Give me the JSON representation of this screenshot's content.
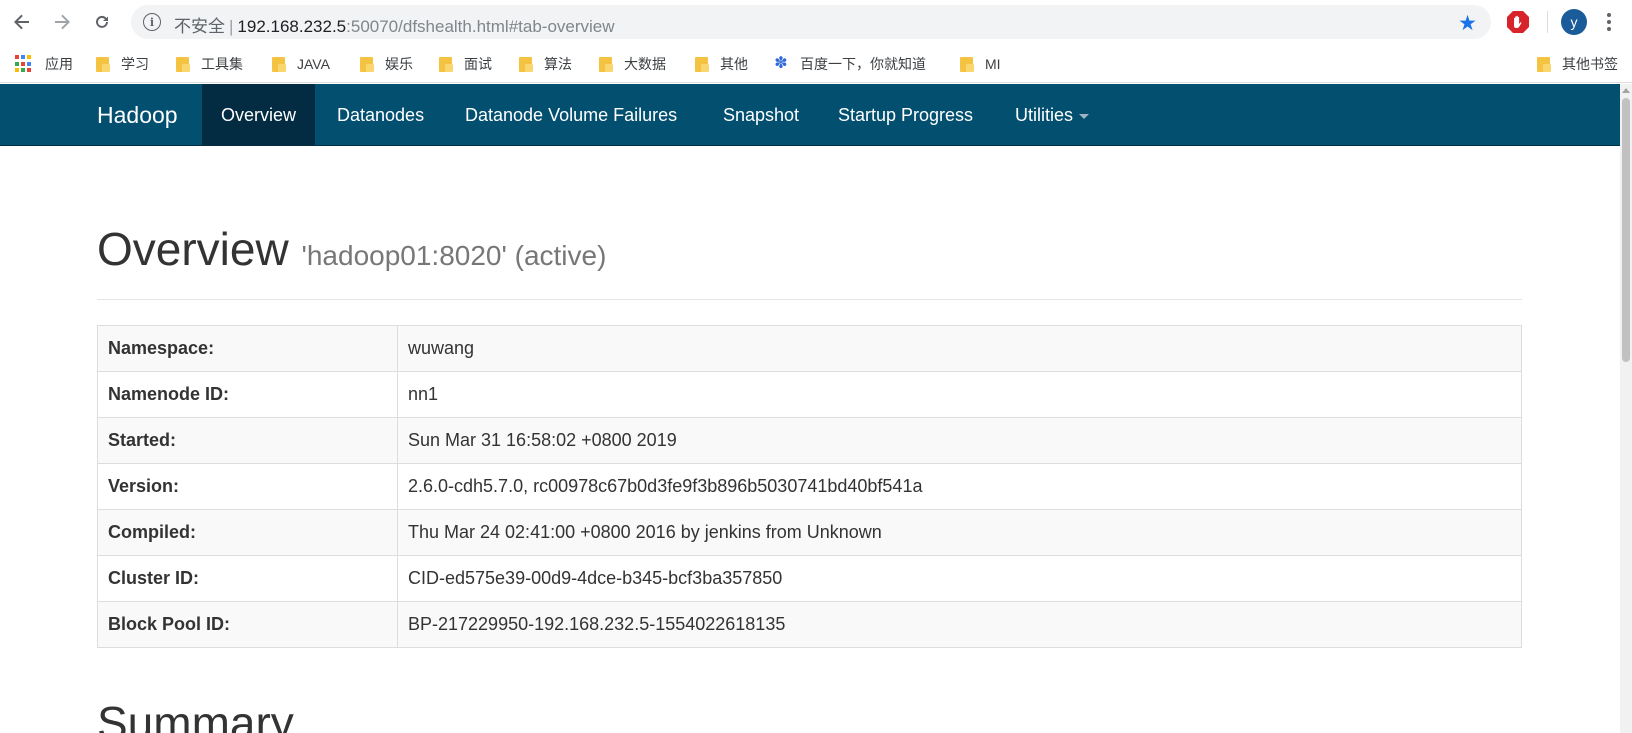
{
  "browser": {
    "nav": {
      "back_icon": "back-arrow-icon",
      "forward_icon": "forward-arrow-icon",
      "reload_icon": "reload-icon"
    },
    "omnibox": {
      "security_label": "不安全",
      "separator": "|",
      "url_host": "192.168.232.5",
      "url_rest": ":50070/dfshealth.html#tab-overview"
    },
    "avatar_initial": "y"
  },
  "bookmarks": [
    {
      "label": "应用",
      "icon": "apps-grid-icon"
    },
    {
      "label": "学习",
      "icon": "folder-icon"
    },
    {
      "label": "工具集",
      "icon": "folder-icon"
    },
    {
      "label": "JAVA",
      "icon": "folder-icon"
    },
    {
      "label": "娱乐",
      "icon": "folder-icon"
    },
    {
      "label": "面试",
      "icon": "folder-icon"
    },
    {
      "label": "算法",
      "icon": "folder-icon"
    },
    {
      "label": "大数据",
      "icon": "folder-icon"
    },
    {
      "label": "其他",
      "icon": "folder-icon"
    },
    {
      "label": "百度一下，你就知道",
      "icon": "baidu-paw-icon"
    },
    {
      "label": "MI",
      "icon": "folder-icon"
    },
    {
      "label": "其他书签",
      "icon": "folder-icon"
    }
  ],
  "navbar": {
    "brand": "Hadoop",
    "items": [
      {
        "label": "Overview",
        "active": true
      },
      {
        "label": "Datanodes",
        "active": false
      },
      {
        "label": "Datanode Volume Failures",
        "active": false
      },
      {
        "label": "Snapshot",
        "active": false
      },
      {
        "label": "Startup Progress",
        "active": false
      },
      {
        "label": "Utilities",
        "active": false,
        "dropdown": true
      }
    ]
  },
  "overview": {
    "title": "Overview",
    "subtitle": "'hadoop01:8020' (active)",
    "rows": [
      {
        "key": "Namespace:",
        "value": "wuwang"
      },
      {
        "key": "Namenode ID:",
        "value": "nn1"
      },
      {
        "key": "Started:",
        "value": "Sun Mar 31 16:58:02 +0800 2019"
      },
      {
        "key": "Version:",
        "value": "2.6.0-cdh5.7.0, rc00978c67b0d3fe9f3b896b5030741bd40bf541a"
      },
      {
        "key": "Compiled:",
        "value": "Thu Mar 24 02:41:00 +0800 2016 by jenkins from Unknown"
      },
      {
        "key": "Cluster ID:",
        "value": "CID-ed575e39-00d9-4dce-b345-bcf3ba357850"
      },
      {
        "key": "Block Pool ID:",
        "value": "BP-217229950-192.168.232.5-1554022618135"
      }
    ]
  },
  "summary": {
    "title": "Summary"
  },
  "colors": {
    "navbar_bg": "#034f70",
    "navbar_active_bg": "#032c42",
    "star": "#1a73e8",
    "avatar_bg": "#1a5b9a"
  }
}
